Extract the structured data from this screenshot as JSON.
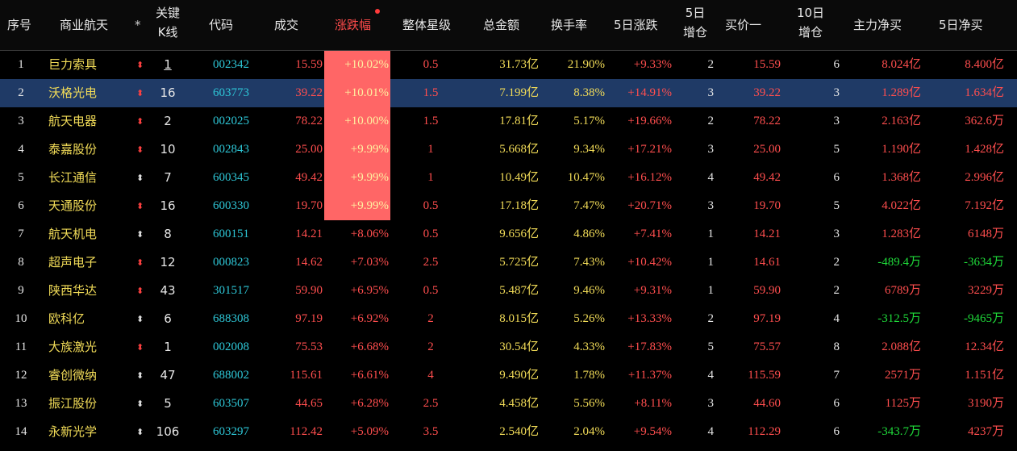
{
  "headers": {
    "seq": "序号",
    "name": "商业航天",
    "star": "*",
    "kline_1": "关键",
    "kline_2": "K线",
    "code": "代码",
    "price": "成交",
    "pct": "涨跌幅",
    "rating": "整体星级",
    "amount": "总金额",
    "turnover": "换手率",
    "chg5": "5日涨跌",
    "add5_1": "5日",
    "add5_2": "增仓",
    "bid1": "买价一",
    "add10_1": "10日",
    "add10_2": "增仓",
    "main_net": "主力净买",
    "net5": "5日净买"
  },
  "colors": {
    "rise": "#ff4e4e",
    "fall": "#1fdc3a",
    "name": "#f2dc58",
    "code": "#2ec8d8",
    "limit_up_bg": "#ff6666",
    "selected_row": "#1f3a66"
  },
  "rows": [
    {
      "seq": "1",
      "name": "巨力索具",
      "arrow": "up",
      "kline": "1",
      "code": "002342",
      "price": "15.59",
      "pct": "+10.02%",
      "limit": true,
      "rating": "0.5",
      "amount": "31.73亿",
      "turnover": "21.90%",
      "chg5": "+9.33%",
      "add5": "2",
      "bid1": "15.59",
      "add10": "6",
      "main_net": "8.024亿",
      "main_dir": "up",
      "net5": "8.400亿",
      "net5_dir": "up"
    },
    {
      "seq": "2",
      "name": "沃格光电",
      "arrow": "up",
      "kline": "16",
      "code": "603773",
      "price": "39.22",
      "pct": "+10.01%",
      "limit": true,
      "rating": "1.5",
      "amount": "7.199亿",
      "turnover": "8.38%",
      "chg5": "+14.91%",
      "add5": "3",
      "bid1": "39.22",
      "add10": "3",
      "main_net": "1.289亿",
      "main_dir": "up",
      "net5": "1.634亿",
      "net5_dir": "up",
      "selected": true
    },
    {
      "seq": "3",
      "name": "航天电器",
      "arrow": "up",
      "kline": "2",
      "code": "002025",
      "price": "78.22",
      "pct": "+10.00%",
      "limit": true,
      "rating": "1.5",
      "amount": "17.81亿",
      "turnover": "5.17%",
      "chg5": "+19.66%",
      "add5": "2",
      "bid1": "78.22",
      "add10": "3",
      "main_net": "2.163亿",
      "main_dir": "up",
      "net5": "362.6万",
      "net5_dir": "up"
    },
    {
      "seq": "4",
      "name": "泰嘉股份",
      "arrow": "up",
      "kline": "10",
      "code": "002843",
      "price": "25.00",
      "pct": "+9.99%",
      "limit": true,
      "rating": "1",
      "amount": "5.668亿",
      "turnover": "9.34%",
      "chg5": "+17.21%",
      "add5": "3",
      "bid1": "25.00",
      "add10": "5",
      "main_net": "1.190亿",
      "main_dir": "up",
      "net5": "1.428亿",
      "net5_dir": "up"
    },
    {
      "seq": "5",
      "name": "长江通信",
      "arrow": "dn",
      "kline": "7",
      "code": "600345",
      "price": "49.42",
      "pct": "+9.99%",
      "limit": true,
      "rating": "1",
      "amount": "10.49亿",
      "turnover": "10.47%",
      "chg5": "+16.12%",
      "add5": "4",
      "bid1": "49.42",
      "add10": "6",
      "main_net": "1.368亿",
      "main_dir": "up",
      "net5": "2.996亿",
      "net5_dir": "up"
    },
    {
      "seq": "6",
      "name": "天通股份",
      "arrow": "up",
      "kline": "16",
      "code": "600330",
      "price": "19.70",
      "pct": "+9.99%",
      "limit": true,
      "rating": "0.5",
      "amount": "17.18亿",
      "turnover": "7.47%",
      "chg5": "+20.71%",
      "add5": "3",
      "bid1": "19.70",
      "add10": "5",
      "main_net": "4.022亿",
      "main_dir": "up",
      "net5": "7.192亿",
      "net5_dir": "up"
    },
    {
      "seq": "7",
      "name": "航天机电",
      "arrow": "dn",
      "kline": "8",
      "code": "600151",
      "price": "14.21",
      "pct": "+8.06%",
      "limit": false,
      "rating": "0.5",
      "amount": "9.656亿",
      "turnover": "4.86%",
      "chg5": "+7.41%",
      "add5": "1",
      "bid1": "14.21",
      "add10": "3",
      "main_net": "1.283亿",
      "main_dir": "up",
      "net5": "6148万",
      "net5_dir": "up"
    },
    {
      "seq": "8",
      "name": "超声电子",
      "arrow": "up",
      "kline": "12",
      "code": "000823",
      "price": "14.62",
      "pct": "+7.03%",
      "limit": false,
      "rating": "2.5",
      "amount": "5.725亿",
      "turnover": "7.43%",
      "chg5": "+10.42%",
      "add5": "1",
      "bid1": "14.61",
      "add10": "2",
      "main_net": "-489.4万",
      "main_dir": "dn",
      "net5": "-3634万",
      "net5_dir": "dn"
    },
    {
      "seq": "9",
      "name": "陕西华达",
      "arrow": "up",
      "kline": "43",
      "code": "301517",
      "price": "59.90",
      "pct": "+6.95%",
      "limit": false,
      "rating": "0.5",
      "amount": "5.487亿",
      "turnover": "9.46%",
      "chg5": "+9.31%",
      "add5": "1",
      "bid1": "59.90",
      "add10": "2",
      "main_net": "6789万",
      "main_dir": "up",
      "net5": "3229万",
      "net5_dir": "up"
    },
    {
      "seq": "10",
      "name": "欧科亿",
      "arrow": "dn",
      "kline": "6",
      "code": "688308",
      "price": "97.19",
      "pct": "+6.92%",
      "limit": false,
      "rating": "2",
      "amount": "8.015亿",
      "turnover": "5.26%",
      "chg5": "+13.33%",
      "add5": "2",
      "bid1": "97.19",
      "add10": "4",
      "main_net": "-312.5万",
      "main_dir": "dn",
      "net5": "-9465万",
      "net5_dir": "dn"
    },
    {
      "seq": "11",
      "name": "大族激光",
      "arrow": "up",
      "kline": "1",
      "code": "002008",
      "price": "75.53",
      "pct": "+6.68%",
      "limit": false,
      "rating": "2",
      "amount": "30.54亿",
      "turnover": "4.33%",
      "chg5": "+17.83%",
      "add5": "5",
      "bid1": "75.57",
      "add10": "8",
      "main_net": "2.088亿",
      "main_dir": "up",
      "net5": "12.34亿",
      "net5_dir": "up"
    },
    {
      "seq": "12",
      "name": "睿创微纳",
      "arrow": "dn",
      "kline": "47",
      "code": "688002",
      "price": "115.61",
      "pct": "+6.61%",
      "limit": false,
      "rating": "4",
      "amount": "9.490亿",
      "turnover": "1.78%",
      "chg5": "+11.37%",
      "add5": "4",
      "bid1": "115.59",
      "add10": "7",
      "main_net": "2571万",
      "main_dir": "up",
      "net5": "1.151亿",
      "net5_dir": "up"
    },
    {
      "seq": "13",
      "name": "振江股份",
      "arrow": "dn",
      "kline": "5",
      "code": "603507",
      "price": "44.65",
      "pct": "+6.28%",
      "limit": false,
      "rating": "2.5",
      "amount": "4.458亿",
      "turnover": "5.56%",
      "chg5": "+8.11%",
      "add5": "3",
      "bid1": "44.60",
      "add10": "6",
      "main_net": "1125万",
      "main_dir": "up",
      "net5": "3190万",
      "net5_dir": "up"
    },
    {
      "seq": "14",
      "name": "永新光学",
      "arrow": "dn",
      "kline": "106",
      "code": "603297",
      "price": "112.42",
      "pct": "+5.09%",
      "limit": false,
      "rating": "3.5",
      "amount": "2.540亿",
      "turnover": "2.04%",
      "chg5": "+9.54%",
      "add5": "4",
      "bid1": "112.29",
      "add10": "6",
      "main_net": "-343.7万",
      "main_dir": "dn",
      "net5": "4237万",
      "net5_dir": "up"
    }
  ]
}
